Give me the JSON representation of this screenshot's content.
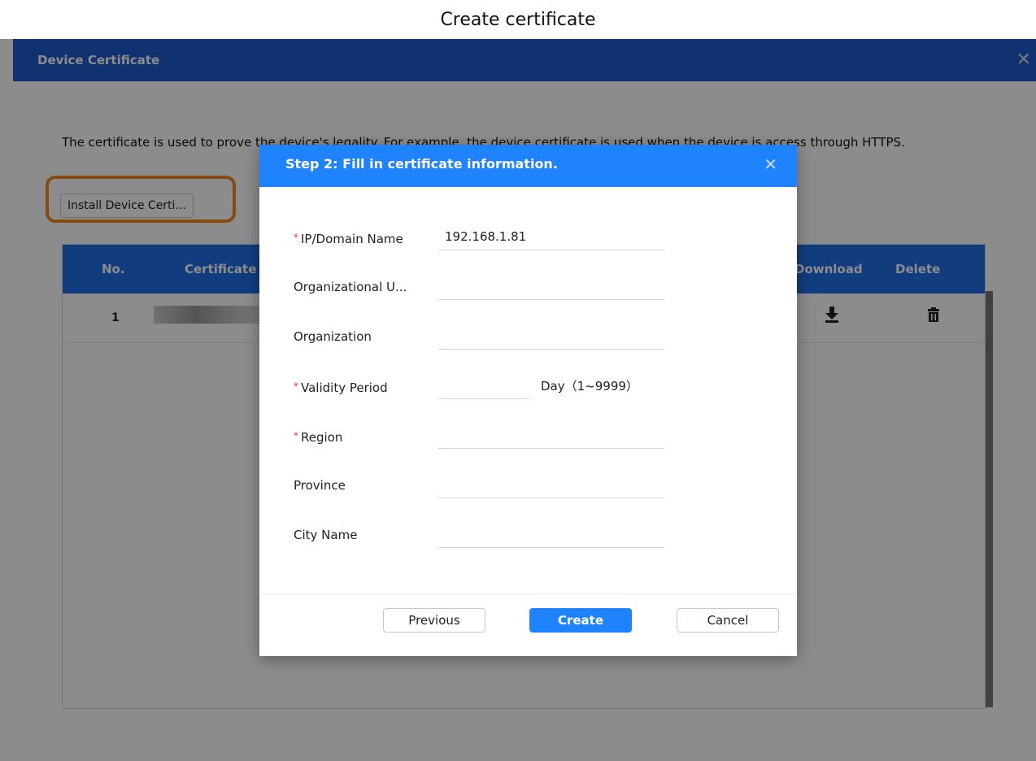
{
  "caption": "Create certificate",
  "window": {
    "title": "Device Certificate",
    "close_glyph": "✕",
    "description": "The certificate is used to prove the device's legality. For example, the device certificate is used when the device is access through HTTPS.",
    "install_button": "Install Device Certi..."
  },
  "table": {
    "headers": {
      "no": "No.",
      "certificate": "Certificate",
      "download": "Download",
      "delete": "Delete"
    },
    "rows": [
      {
        "no": "1",
        "download_icon": "download-icon",
        "delete_icon": "trash-icon"
      }
    ]
  },
  "dialog": {
    "title": "Step 2: Fill in certificate information.",
    "close_glyph": "✕",
    "required_mark": "*",
    "fields": {
      "ip_domain": {
        "label": "IP/Domain Name",
        "value": "192.168.1.81"
      },
      "org_unit": {
        "label": "Organizational U...",
        "value": ""
      },
      "organization": {
        "label": "Organization",
        "value": ""
      },
      "validity": {
        "label": "Validity Period",
        "value": "",
        "unit": "Day（1~9999）"
      },
      "region": {
        "label": "Region",
        "value": ""
      },
      "province": {
        "label": "Province",
        "value": ""
      },
      "city": {
        "label": "City Name",
        "value": ""
      }
    },
    "buttons": {
      "previous": "Previous",
      "create": "Create",
      "cancel": "Cancel"
    }
  },
  "colors": {
    "window_header": "#1f5ccc",
    "table_header": "#1f6fe8",
    "dialog_header": "#1f82ff",
    "highlight_ring": "#f08a24",
    "required": "#e53935"
  }
}
